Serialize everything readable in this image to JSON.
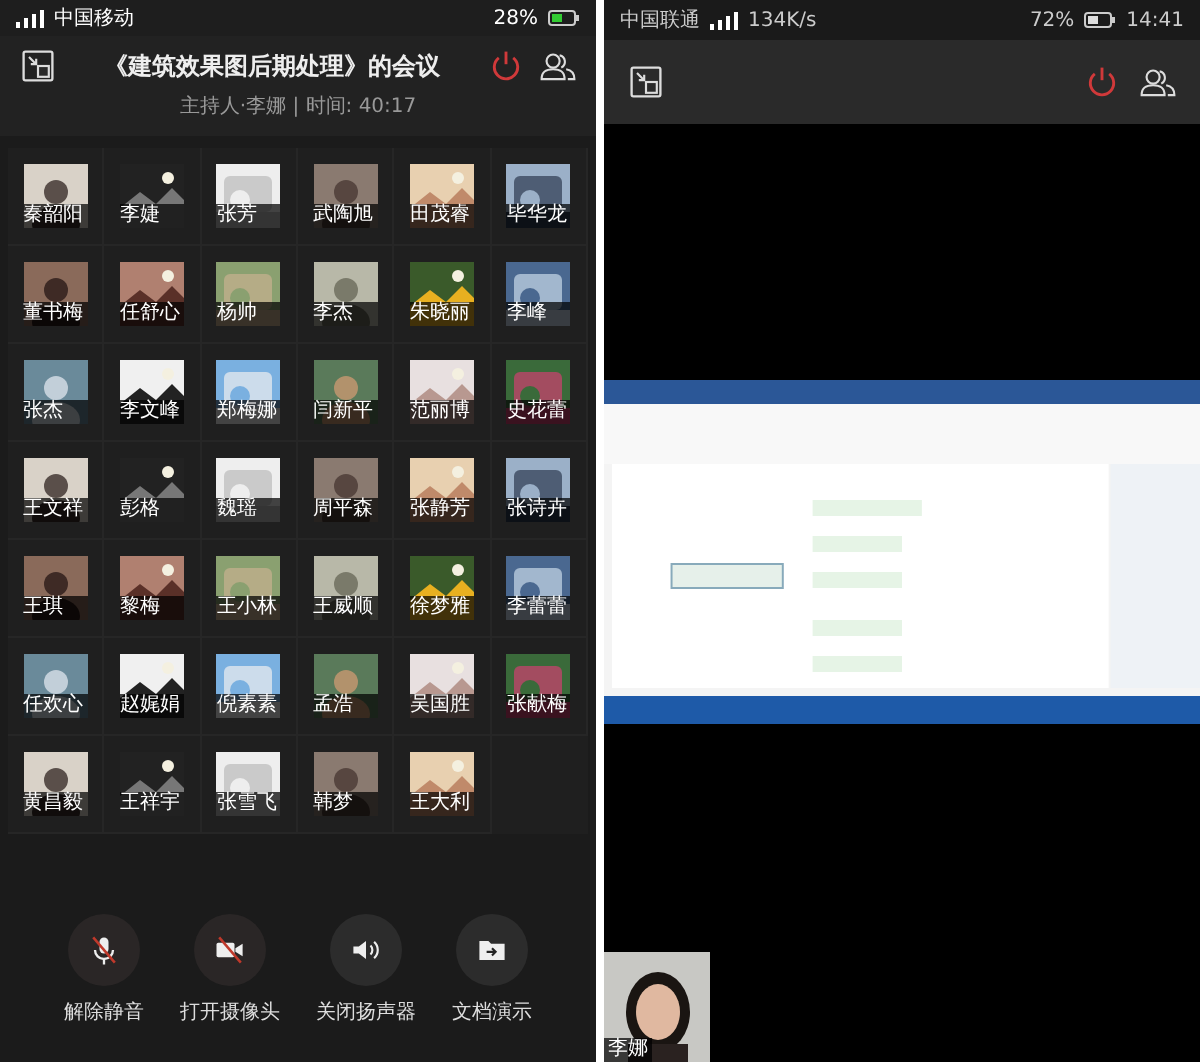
{
  "left_phone": {
    "status_bar": {
      "carrier": "中国移动",
      "battery": "28%"
    },
    "header": {
      "title": "《建筑效果图后期处理》的会议",
      "subtitle": "主持人·李娜 | 时间: 40:17"
    },
    "participants": [
      {
        "name": "秦韶阳"
      },
      {
        "name": "李婕"
      },
      {
        "name": "张芳"
      },
      {
        "name": "武陶旭"
      },
      {
        "name": "田茂睿"
      },
      {
        "name": "毕华龙"
      },
      {
        "name": "董书梅"
      },
      {
        "name": "任舒心"
      },
      {
        "name": "杨帅"
      },
      {
        "name": "李杰"
      },
      {
        "name": "朱晓丽"
      },
      {
        "name": "李峰"
      },
      {
        "name": "张杰"
      },
      {
        "name": "李文峰"
      },
      {
        "name": "郑梅娜"
      },
      {
        "name": "闫新平"
      },
      {
        "name": "范丽博"
      },
      {
        "name": "史花蕾"
      },
      {
        "name": "王文祥"
      },
      {
        "name": "彭格"
      },
      {
        "name": "魏瑶"
      },
      {
        "name": "周平森"
      },
      {
        "name": "张静芳"
      },
      {
        "name": "张诗卉"
      },
      {
        "name": "王琪"
      },
      {
        "name": "黎梅"
      },
      {
        "name": "王小林"
      },
      {
        "name": "王威顺"
      },
      {
        "name": "徐梦雅"
      },
      {
        "name": "李蕾蕾"
      },
      {
        "name": "任欢心"
      },
      {
        "name": "赵娓娟"
      },
      {
        "name": "倪素素"
      },
      {
        "name": "孟浩"
      },
      {
        "name": "吴国胜"
      },
      {
        "name": "张献梅"
      },
      {
        "name": "黄昌毅"
      },
      {
        "name": "王祥宇"
      },
      {
        "name": "张雪飞"
      },
      {
        "name": "韩梦"
      },
      {
        "name": "王大利"
      }
    ],
    "controls": [
      {
        "kind": "mic",
        "label": "解除静音",
        "off": true
      },
      {
        "kind": "camera",
        "label": "打开摄像头",
        "off": true
      },
      {
        "kind": "speaker",
        "label": "关闭扬声器",
        "off": false
      },
      {
        "kind": "document",
        "label": "文档演示",
        "off": false
      }
    ]
  },
  "right_phone": {
    "status_bar": {
      "carrier": "中国联通",
      "speed": "134K/s",
      "battery": "72%",
      "time": "14:41"
    },
    "presenter": {
      "name": "李娜"
    }
  }
}
